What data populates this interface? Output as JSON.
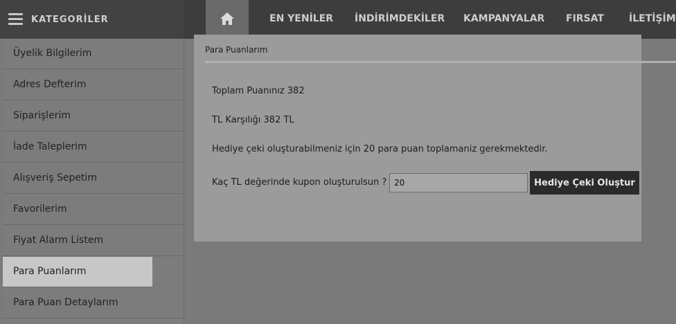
{
  "header": {
    "categories_title": "KATEGORİLER",
    "nav": [
      "EN YENİLER",
      "İNDİRİMDEKİLER",
      "KAMPANYALAR",
      "FIRSAT",
      "İLETİŞİM"
    ]
  },
  "sidebar": {
    "items": [
      {
        "label": "Üyelik Bilgilerim"
      },
      {
        "label": "Adres Defterim"
      },
      {
        "label": "Siparişlerim"
      },
      {
        "label": "İade Taleplerim"
      },
      {
        "label": "Alışveriş Sepetim"
      },
      {
        "label": "Favorilerim"
      },
      {
        "label": "Fiyat Alarm Listem"
      },
      {
        "label": "Para Puanlarım"
      },
      {
        "label": "Para Puan Detaylarım"
      }
    ],
    "active_item": "Para Puanlarım"
  },
  "panel": {
    "title": "Para Puanlarım",
    "total_points": "Toplam Puanınız 382",
    "tl_equivalent": "TL Karşılığı 382 TL",
    "info": "Hediye çeki oluşturabilmeniz için 20 para puan toplamaniz gerekmektedir.",
    "coupon_label": "Kaç TL değerinde kupon oluşturulsun ?",
    "coupon_value": "20",
    "button_label": "Hediye Çeki Oluştur"
  }
}
